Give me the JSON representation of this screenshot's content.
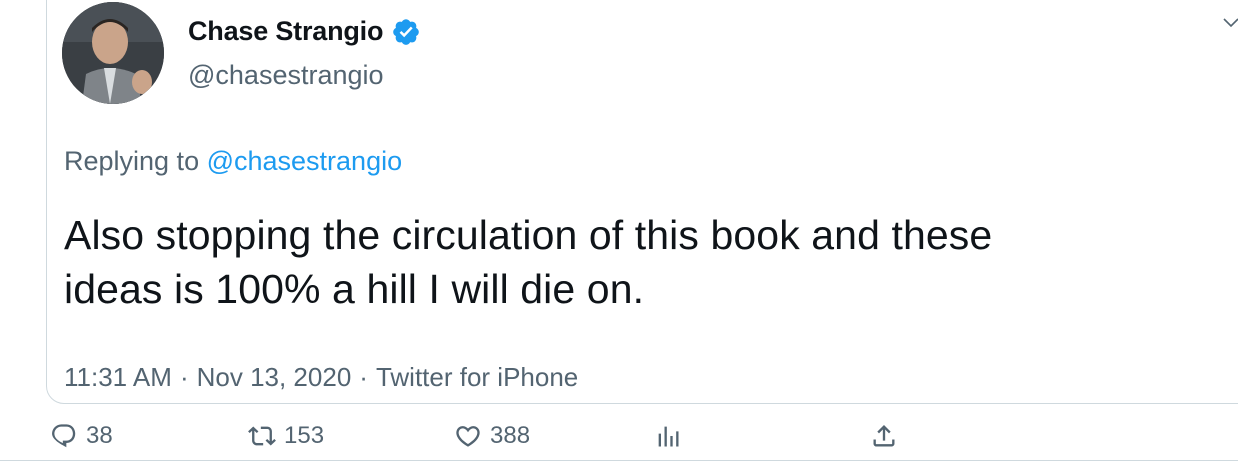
{
  "tweet": {
    "author_name": "Chase Strangio",
    "author_handle": "@chasestrangio",
    "replying_prefix": "Replying to ",
    "replying_handle": "@chasestrangio",
    "text_line1": "Also stopping the circulation of this book and these",
    "text_line2": "ideas is 100% a hill I will die on.",
    "time": "11:31 AM",
    "separator": "·",
    "date": "Nov 13, 2020",
    "source": "Twitter for iPhone"
  },
  "actions": {
    "replies": "38",
    "retweets": "153",
    "likes": "388"
  },
  "colors": {
    "link": "#1d9bf0",
    "muted": "#536471",
    "text": "#0f1419",
    "border": "#cfd9de"
  },
  "icons": [
    "verified-badge-icon",
    "chevron-down-icon",
    "reply-icon",
    "retweet-icon",
    "like-icon",
    "analytics-icon",
    "share-icon"
  ]
}
